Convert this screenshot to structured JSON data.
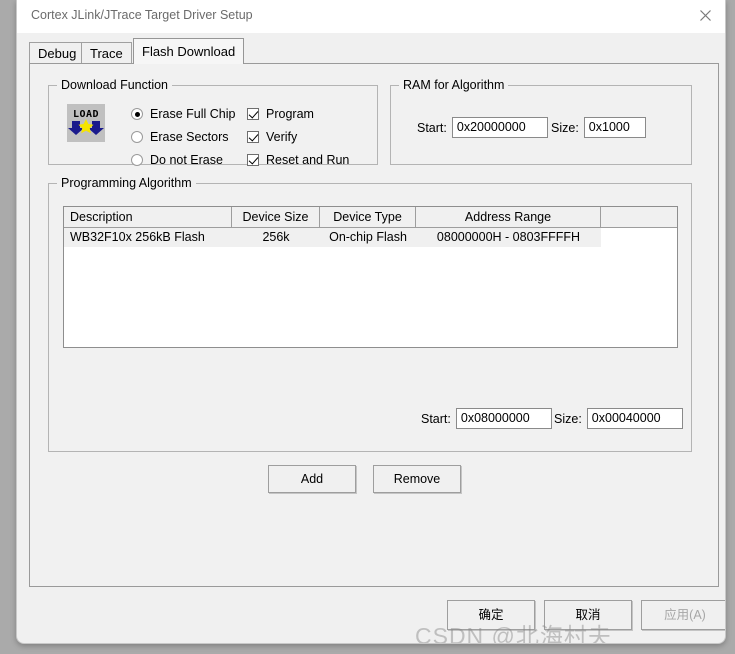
{
  "window": {
    "title": "Cortex JLink/JTrace Target Driver Setup",
    "close_icon": "close-icon"
  },
  "tabs": [
    {
      "id": "debug",
      "label": "Debug",
      "active": false
    },
    {
      "id": "trace",
      "label": "Trace",
      "active": false
    },
    {
      "id": "flash",
      "label": "Flash Download",
      "active": true
    }
  ],
  "download_function": {
    "group_title": "Download Function",
    "icon_label": "LOAD",
    "radios": [
      {
        "label": "Erase Full Chip",
        "checked": true
      },
      {
        "label": "Erase Sectors",
        "checked": false
      },
      {
        "label": "Do not Erase",
        "checked": false
      }
    ],
    "checkboxes": [
      {
        "label": "Program",
        "checked": true
      },
      {
        "label": "Verify",
        "checked": true
      },
      {
        "label": "Reset and Run",
        "checked": true
      }
    ]
  },
  "ram_for_algorithm": {
    "group_title": "RAM for Algorithm",
    "start_label": "Start:",
    "start_value": "0x20000000",
    "size_label": "Size:",
    "size_value": "0x1000"
  },
  "programming_algorithm": {
    "group_title": "Programming Algorithm",
    "columns": [
      "Description",
      "Device Size",
      "Device Type",
      "Address Range",
      ""
    ],
    "rows": [
      {
        "description": "WB32F10x 256kB Flash",
        "device_size": "256k",
        "device_type": "On-chip Flash",
        "address_range": "08000000H - 0803FFFFH",
        "extra": "",
        "selected": true
      }
    ],
    "start_label": "Start:",
    "start_value": "0x08000000",
    "size_label": "Size:",
    "size_value": "0x00040000"
  },
  "actions": {
    "add_label": "Add",
    "remove_label": "Remove"
  },
  "footer": {
    "ok_label": "确定",
    "cancel_label": "取消",
    "apply_label": "应用(A)",
    "apply_disabled": true
  },
  "watermark": {
    "text": "CSDN @北海村夫"
  },
  "colors": {
    "window_bg": "#f0f0f0",
    "panel_bg": "#f1f1f1",
    "desktop_bg": "#aaaaaa",
    "titlebar_bg": "#ffffff",
    "title_text": "#6b6b6b",
    "icon_navy": "#1a1a8c",
    "icon_yellow": "#f5e400",
    "row_selected_bg": "#f0f0f0"
  }
}
